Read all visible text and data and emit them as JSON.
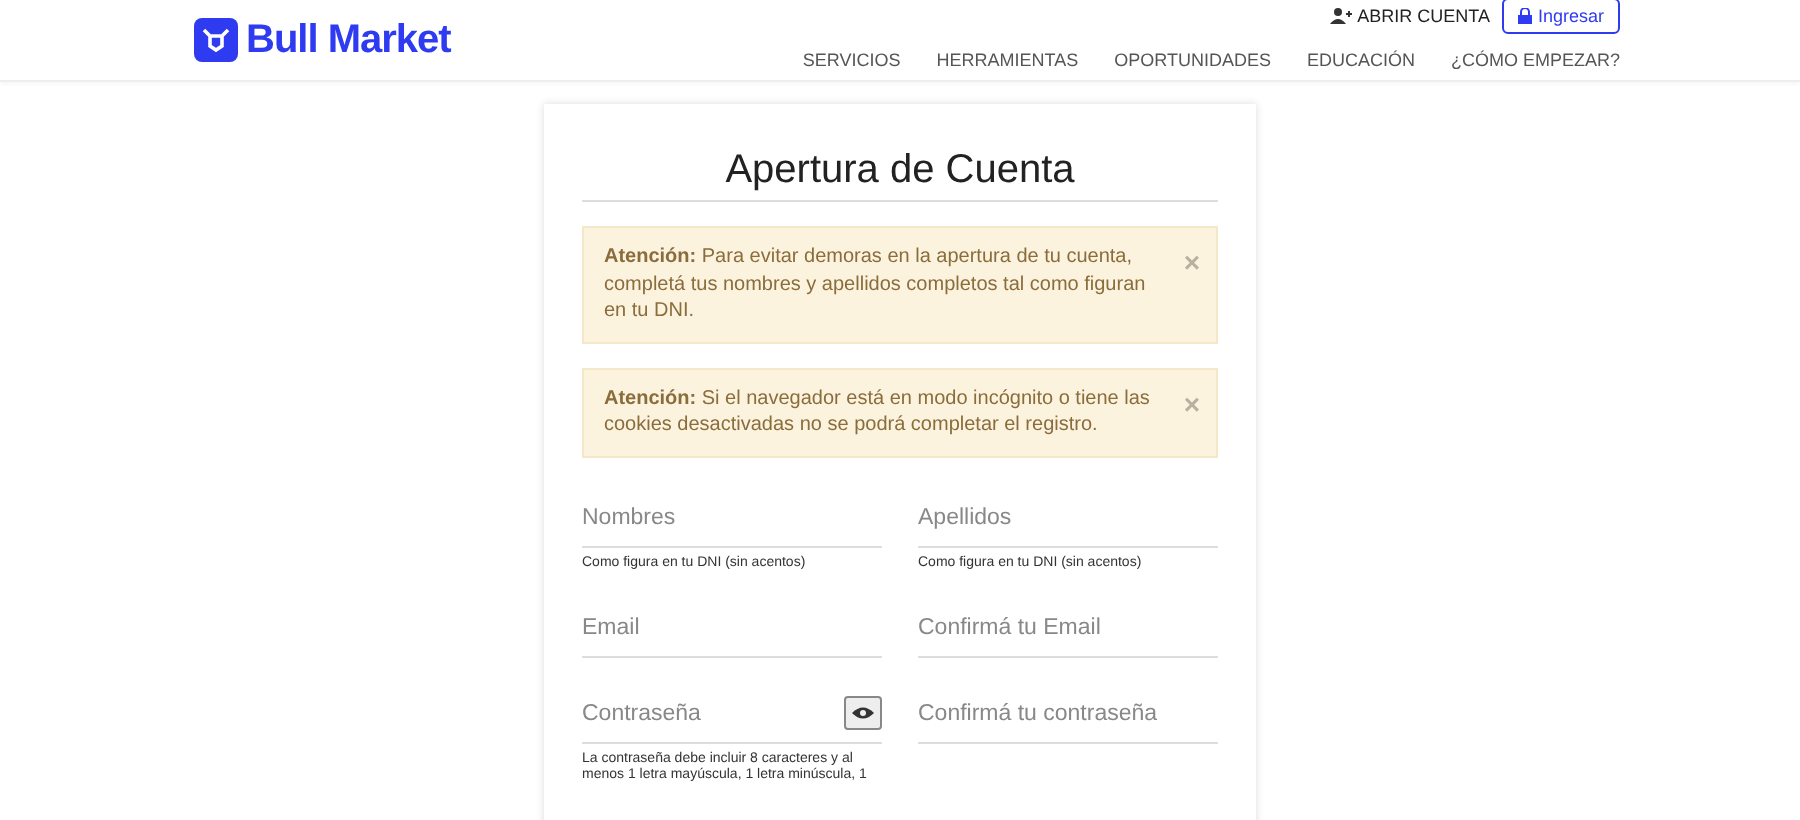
{
  "header": {
    "logo": "Bull Market",
    "account_link": "ABRIR CUENTA",
    "login_button": "Ingresar",
    "nav": [
      "SERVICIOS",
      "HERRAMIENTAS",
      "OPORTUNIDADES",
      "EDUCACIÓN",
      "¿CÓMO EMPEZAR?"
    ]
  },
  "form": {
    "title": "Apertura de Cuenta",
    "alerts": [
      {
        "text": "**Atención:** Para evitar demoras en la apertura de tu cuenta, completá tus nombres y apellidos completos tal como figuran en tu DNI.",
        "close": "×"
      },
      {
        "text": "**Atención:** Si el navegador está en modo incógnito o tiene las cookies desactivadas no se podrá completar el registro.",
        "close": "×"
      }
    ],
    "fields": [
      {
        "placeholder": "Nombres",
        "hint": "Como figura en tu DNI (sin acentos)",
        "kind": "text"
      },
      {
        "placeholder": "Apellidos",
        "hint": "Como figura en tu DNI (sin acentos)",
        "kind": "text"
      },
      {
        "placeholder": "Email",
        "kind": "text"
      },
      {
        "placeholder": "Confirmá tu Email",
        "kind": "text"
      },
      {
        "placeholder": "Contraseña",
        "hint": "La contraseña debe incluir 8 caracteres y al menos 1 letra mayúscula, 1 letra minúscula, 1",
        "kind": "password"
      },
      {
        "placeholder": "Confirmá tu contraseña",
        "kind": "text"
      }
    ]
  }
}
